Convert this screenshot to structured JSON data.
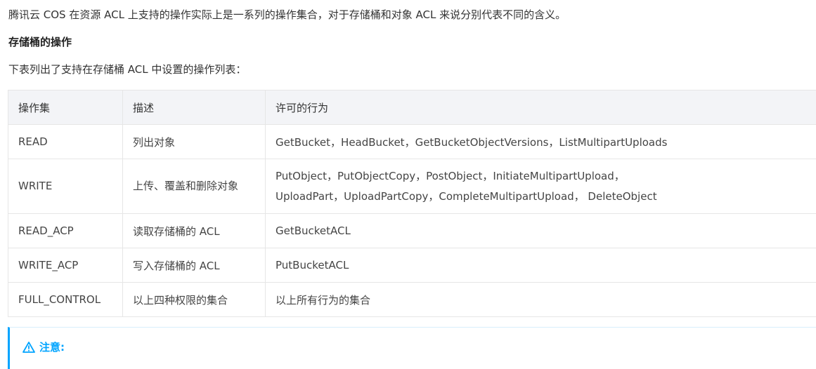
{
  "intro": "腾讯云 COS 在资源 ACL 上支持的操作实际上是一系列的操作集合，对于存储桶和对象 ACL 来说分别代表不同的含义。",
  "section_title": "存储桶的操作",
  "table_intro": "下表列出了支持在存储桶 ACL 中设置的操作列表：",
  "table": {
    "headers": [
      "操作集",
      "描述",
      "许可的行为"
    ],
    "rows": [
      {
        "op": "READ",
        "desc": "列出对象",
        "behavior": [
          "GetBucket，HeadBucket，GetBucketObjectVersions，ListMultipartUploads"
        ]
      },
      {
        "op": "WRITE",
        "desc": "上传、覆盖和删除对象",
        "behavior": [
          "PutObject，PutObjectCopy，PostObject，InitiateMultipartUpload，",
          "UploadPart，UploadPartCopy，CompleteMultipartUpload， DeleteObject"
        ]
      },
      {
        "op": "READ_ACP",
        "desc": "读取存储桶的 ACL",
        "behavior": [
          "GetBucketACL"
        ]
      },
      {
        "op": "WRITE_ACP",
        "desc": "写入存储桶的 ACL",
        "behavior": [
          "PutBucketACL"
        ]
      },
      {
        "op": "FULL_CONTROL",
        "desc": "以上四种权限的集合",
        "behavior": [
          "以上所有行为的集合"
        ]
      }
    ]
  },
  "notice": {
    "icon": "warning-icon",
    "title": "注意:"
  },
  "colors": {
    "accent": "#00a4ff",
    "header_bg": "#f3f4f7",
    "border": "#e6e6e6",
    "text": "#333333"
  }
}
